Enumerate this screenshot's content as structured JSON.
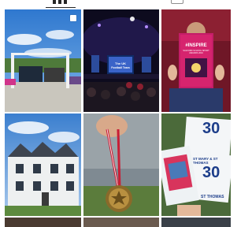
{
  "tabs": {
    "active": "posts-grid",
    "items": [
      {
        "name": "posts-grid-tab",
        "icon": "grid-icon"
      },
      {
        "name": "tagged-tab",
        "icon": "tagged-person-icon"
      }
    ]
  },
  "posts": [
    {
      "icon": "carousel-icon"
    },
    {
      "screen_line1": "The UK",
      "screen_line2": "Football Team"
    },
    {
      "poster_title": "#INSPIRE",
      "poster_subtitle": "SALFORD SCHOOL SPORT AWARDS 2016"
    },
    {},
    {},
    {
      "number_top": "30",
      "card_text1": "ST MARY & ST THOMAS",
      "card_text2": "ST THOMAS",
      "number_bottom": "30"
    }
  ],
  "colors": {
    "active_tab": "#262626",
    "inactive_tab": "#8e8e8e",
    "sky_blue": "#3b86d6",
    "poster_pink": "#d6246e"
  }
}
